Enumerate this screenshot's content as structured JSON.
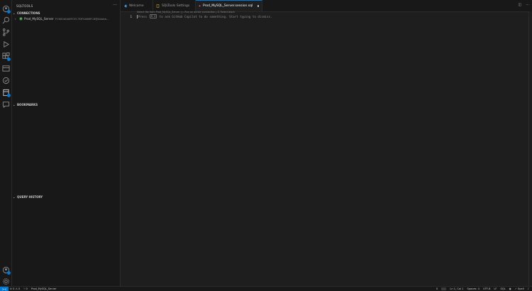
{
  "colors": {
    "accent": "#0078d4",
    "background": "#1e1e1e",
    "sidebar": "#181818"
  },
  "activity_bar": {
    "items": [
      {
        "name": "accounts-badge-icon",
        "badge": true
      },
      {
        "name": "search-icon"
      },
      {
        "name": "source-control-icon"
      },
      {
        "name": "run-debug-icon"
      },
      {
        "name": "extensions-icon",
        "badge": true
      },
      {
        "name": "sqltools-icon"
      },
      {
        "name": "testing-icon"
      },
      {
        "name": "database-explorer-icon",
        "badge": true
      },
      {
        "name": "chat-icon"
      }
    ],
    "bottom": [
      {
        "name": "account-icon",
        "badge": true
      },
      {
        "name": "settings-gear-icon"
      }
    ]
  },
  "sidebar": {
    "title": "SQLTOOLS",
    "more": "···",
    "sections": {
      "connections": "CONNECTIONS",
      "bookmarks": "BOOKMARKS",
      "query_history": "QUERY HISTORY"
    },
    "connection": {
      "name": "Prod_MySQL_Server",
      "id": "FC600A0A6FCEC7DF0A68FC8@Adobe..."
    }
  },
  "tabs": [
    {
      "label": "Welcome",
      "icon": "vscode-logo-icon",
      "active": false
    },
    {
      "label": "SQLTools Settings",
      "icon": "settings-file-icon",
      "active": false
    },
    {
      "label": "Prod_MySQL_Server.session.sql",
      "icon": "sql-file-icon",
      "active": true,
      "dirty": true
    }
  ],
  "editor": {
    "codelens": "Select file from Prod_MySQL_Server | ▷ Run on active connection | ⊡ Select block",
    "line_number": "1",
    "hint_before": "Press ",
    "hint_key": "⌘ I",
    "hint_after": " to ask GitHub Copilot to do something. Start typing to dismiss."
  },
  "statusbar": {
    "remote": "><",
    "problems": "⊘ 0 ⚠ 0",
    "ports": "⑂ 0",
    "connection": "Prod_MySQL_Server",
    "notifications_count": "0",
    "position": "Ln 1, Col 1",
    "spaces": "Spaces: 4",
    "encoding": "UTF-8",
    "eol": "LF",
    "language": "SQL",
    "spell": "✓ Spell"
  }
}
